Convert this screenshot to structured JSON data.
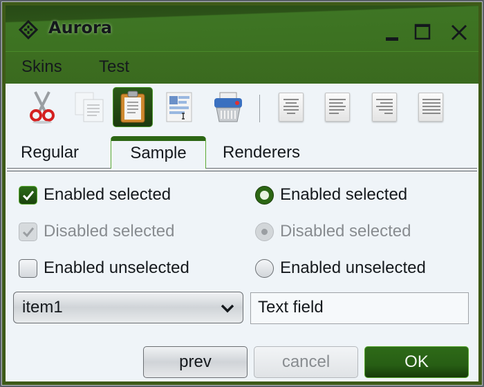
{
  "window": {
    "title": "Aurora",
    "controls": {
      "minimize": "minimize-icon",
      "maximize": "maximize-icon",
      "close": "close-icon"
    }
  },
  "menubar": {
    "items": [
      {
        "label": "Skins"
      },
      {
        "label": "Test"
      }
    ]
  },
  "toolbar": {
    "buttons": [
      {
        "name": "cut",
        "icon": "scissors-icon",
        "enabled": true,
        "active": false
      },
      {
        "name": "copy",
        "icon": "copy-icon",
        "enabled": false,
        "active": false
      },
      {
        "name": "paste",
        "icon": "clipboard-icon",
        "enabled": true,
        "active": true
      },
      {
        "name": "select-all",
        "icon": "text-select-icon",
        "enabled": true,
        "active": false
      },
      {
        "name": "delete",
        "icon": "shredder-icon",
        "enabled": true,
        "active": false
      },
      {
        "name": "align-center",
        "icon": "align-center-icon",
        "enabled": true,
        "active": false
      },
      {
        "name": "align-left",
        "icon": "align-left-icon",
        "enabled": true,
        "active": false
      },
      {
        "name": "align-right",
        "icon": "align-right-icon",
        "enabled": true,
        "active": false
      },
      {
        "name": "align-justify",
        "icon": "align-justify-icon",
        "enabled": true,
        "active": false
      }
    ]
  },
  "tabs": {
    "items": [
      {
        "label": "Regular"
      },
      {
        "label": "Sample"
      },
      {
        "label": "Renderers"
      }
    ],
    "selected": "Sample"
  },
  "checkboxes": [
    {
      "label": "Enabled selected",
      "checked": true,
      "enabled": true
    },
    {
      "label": "Disabled selected",
      "checked": true,
      "enabled": false
    },
    {
      "label": "Enabled unselected",
      "checked": false,
      "enabled": true
    }
  ],
  "radios": [
    {
      "label": "Enabled selected",
      "checked": true,
      "enabled": true
    },
    {
      "label": "Disabled selected",
      "checked": true,
      "enabled": false
    },
    {
      "label": "Enabled unselected",
      "checked": false,
      "enabled": true
    }
  ],
  "combo": {
    "value": "item1"
  },
  "textfield": {
    "value": "Text field"
  },
  "buttons": {
    "prev": {
      "label": "prev",
      "enabled": true
    },
    "cancel": {
      "label": "cancel",
      "enabled": false
    },
    "ok": {
      "label": "OK",
      "enabled": true
    }
  },
  "colors": {
    "accent": "#2c6614",
    "titlebar": "#3c7020",
    "background": "#eff4f8"
  }
}
